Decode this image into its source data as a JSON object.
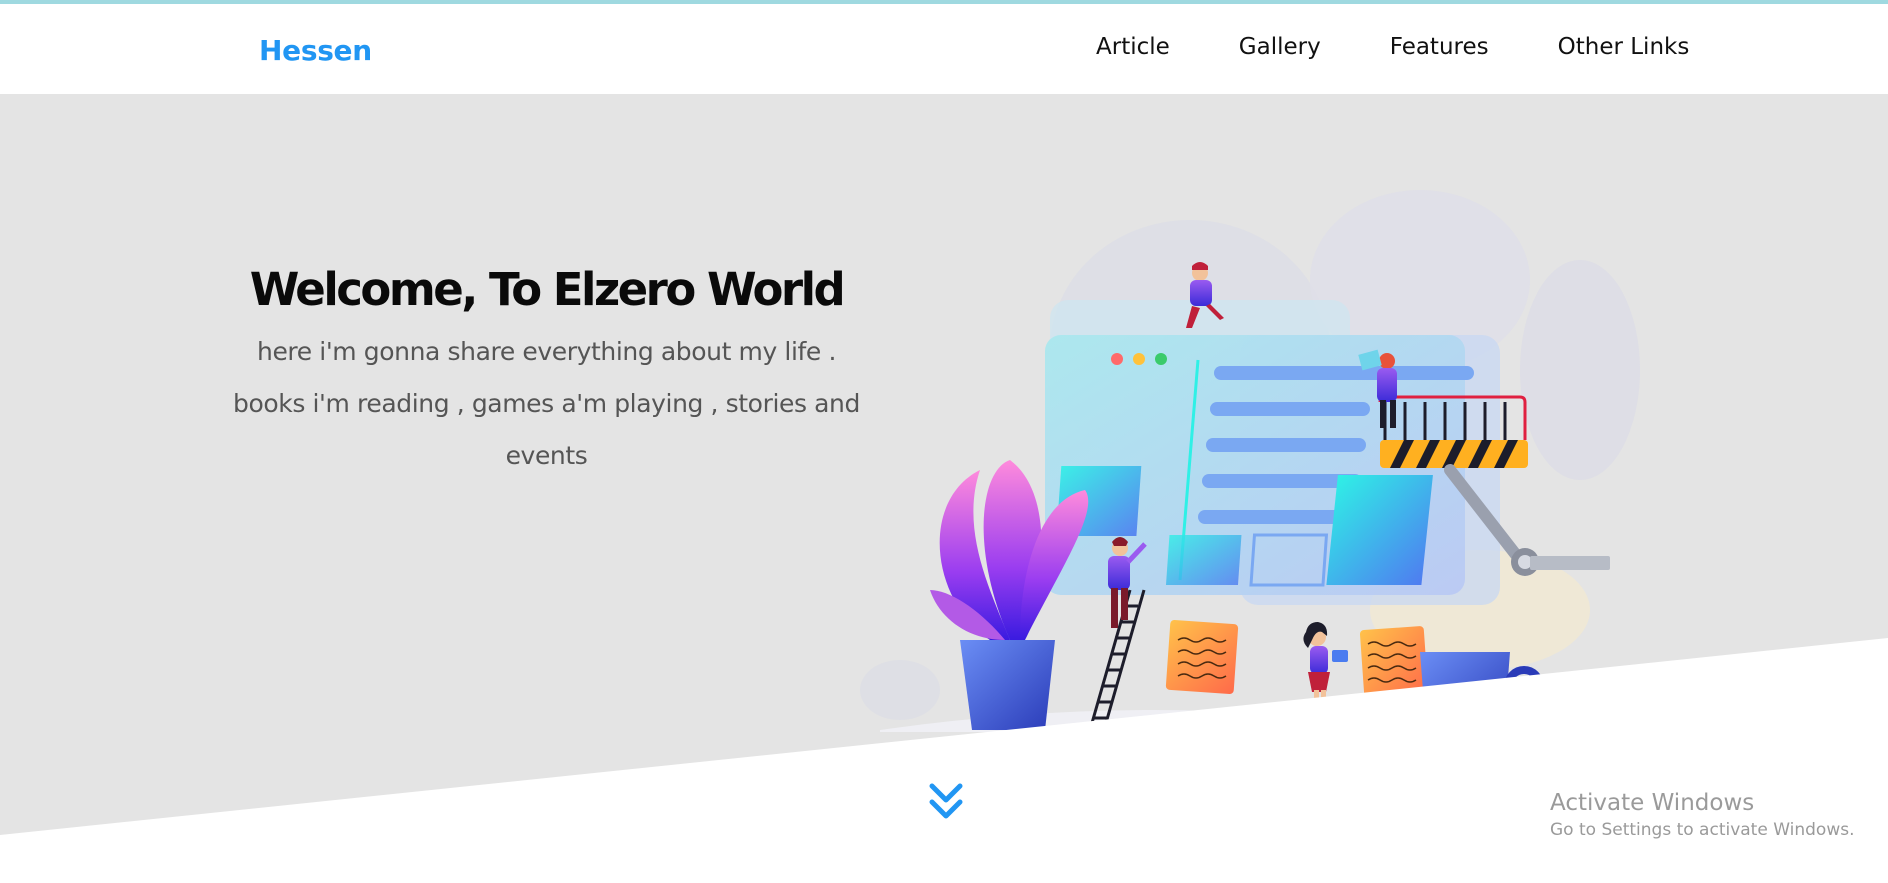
{
  "header": {
    "logo": "Hessen",
    "nav": [
      {
        "label": "Article"
      },
      {
        "label": "Gallery"
      },
      {
        "label": "Features"
      },
      {
        "label": "Other Links"
      }
    ]
  },
  "hero": {
    "title": "Welcome, To Elzero World",
    "description": "here i'm gonna share everything about my life . books i'm reading , games a'm playing , stories and events",
    "illustration_icon": "team-building-website-illustration"
  },
  "scroll": {
    "icon": "double-chevron-down-icon"
  },
  "watermark": {
    "title": "Activate Windows",
    "subtitle": "Go to Settings to activate Windows."
  },
  "colors": {
    "accent": "#2196f3",
    "hero_bg": "#e4e4e4",
    "top_strip": "#9fd9e0",
    "text_dark": "#0a0a0a",
    "text_muted": "#555555"
  }
}
